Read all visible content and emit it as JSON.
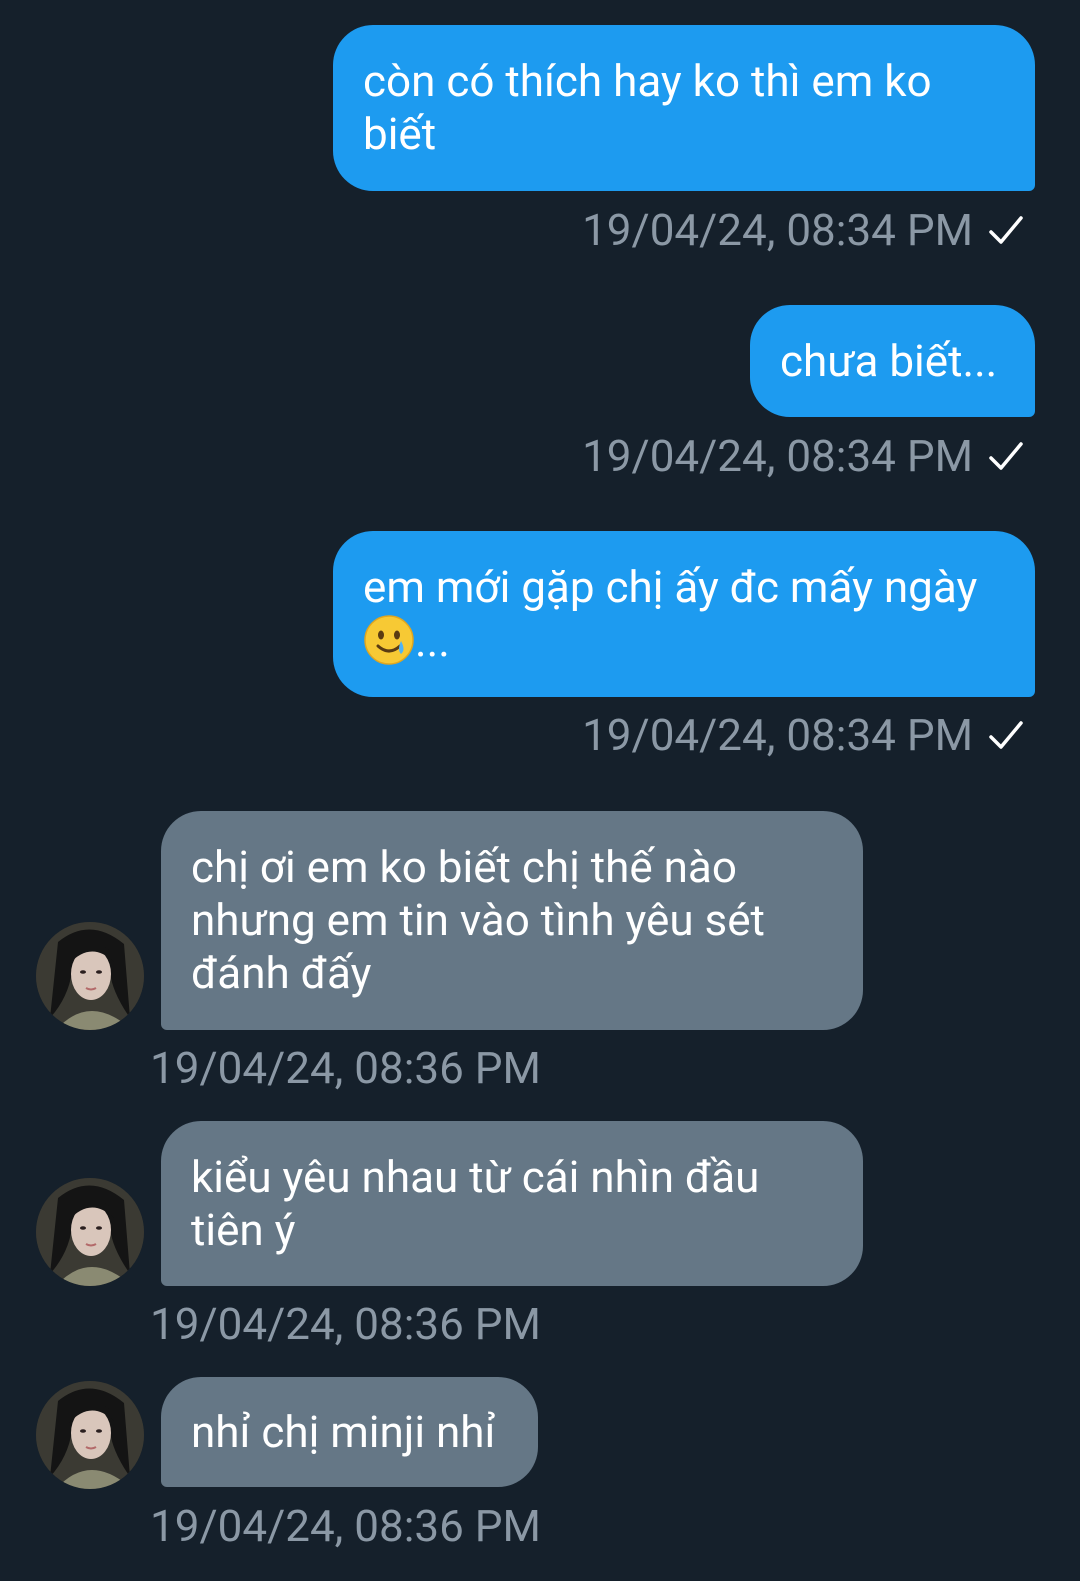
{
  "messages": [
    {
      "direction": "sent",
      "text_lines": [
        "còn có thích hay ko thì em ko",
        "biết"
      ],
      "timestamp": "19/04/24, 08:34 PM",
      "status": "check-icon"
    },
    {
      "direction": "sent",
      "text_lines": [
        "chưa biết..."
      ],
      "timestamp": "19/04/24, 08:34 PM",
      "status": "check-icon"
    },
    {
      "direction": "sent",
      "text_lines": [
        "em mới gặp chị ấy đc mấy ngày"
      ],
      "text_suffix": "...",
      "emoji": "smiling-face-with-tear-emoji",
      "timestamp": "19/04/24, 08:34 PM",
      "status": "check-icon"
    },
    {
      "direction": "received",
      "text_lines": [
        "chị ơi em ko biết chị thế nào",
        "nhưng em tin vào tình yêu sét",
        "đánh đấy"
      ],
      "timestamp": "19/04/24, 08:36 PM"
    },
    {
      "direction": "received",
      "text_lines": [
        "kiểu yêu nhau từ cái nhìn đầu",
        "tiên ý"
      ],
      "timestamp": "19/04/24, 08:36 PM"
    },
    {
      "direction": "received",
      "text_lines": [
        "nhỉ chị minji nhỉ"
      ],
      "timestamp": "19/04/24, 08:36 PM"
    }
  ],
  "colors": {
    "background": "#15202b",
    "sent_bubble": "#1d9bf0",
    "received_bubble": "#657786",
    "timestamp": "#8b98a5"
  }
}
